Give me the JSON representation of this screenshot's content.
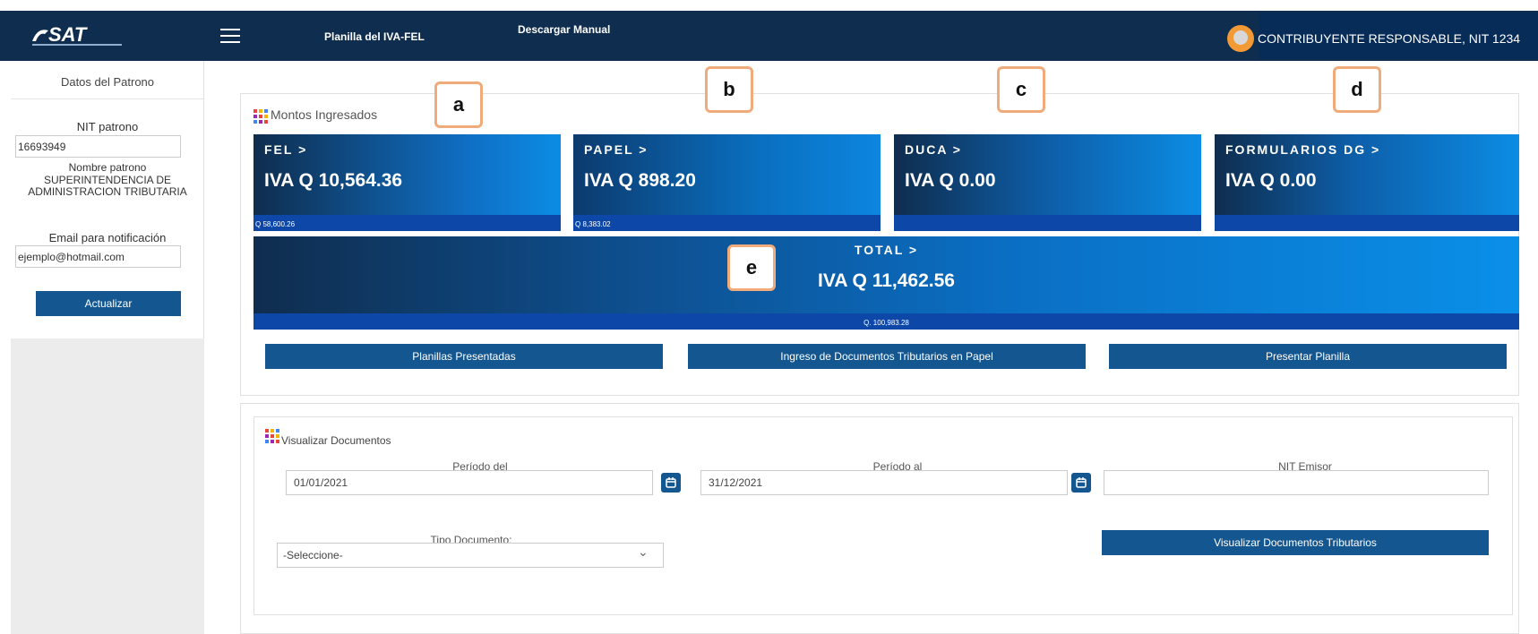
{
  "header": {
    "logo_text": "SAT",
    "menu_icon": "hamburger-icon",
    "planilla_link": "Planilla del IVA-FEL",
    "manual_link": "Descargar Manual",
    "user_label": "CONTRIBUYENTE RESPONSABLE, NIT 1234",
    "colors": {
      "bar": "#0f2d4e",
      "user_box": "#082c58"
    }
  },
  "sidebar": {
    "title": "Datos del Patrono",
    "nit_label": "NIT patrono",
    "nit_value": "16693949",
    "nombre_label": "Nombre patrono",
    "nombre_value": "SUPERINTENDENCIA DE ADMINISTRACION TRIBUTARIA",
    "email_label": "Email para notificación",
    "email_value": "ejemplo@hotmail.com",
    "update_button": "Actualizar"
  },
  "montos": {
    "title": "Montos Ingresados",
    "cards": [
      {
        "title": "FEL  >",
        "value": "IVA Q 10,564.36",
        "sub": "Q 58,600.26"
      },
      {
        "title": "PAPEL  >",
        "value": "IVA Q 898.20",
        "sub": "Q 8,383.02"
      },
      {
        "title": "DUCA  >",
        "value": "IVA Q 0.00",
        "sub": ""
      },
      {
        "title": "FORMULARIOS DG  >",
        "value": "IVA Q 0.00",
        "sub": ""
      }
    ],
    "total": {
      "title": "TOTAL  >",
      "value": "IVA Q 11,462.56",
      "sub": "Q. 100,983.28"
    },
    "buttons": {
      "planillas": "Planillas Presentadas",
      "ingreso": "Ingreso de Documentos Tributarios en Papel",
      "presentar": "Presentar Planilla"
    }
  },
  "annotations": [
    "a",
    "b",
    "c",
    "d",
    "e"
  ],
  "visualizar": {
    "title": "Visualizar Documentos",
    "periodo_del_label": "Período del",
    "periodo_del_value": "01/01/2021",
    "periodo_al_label": "Período al",
    "periodo_al_value": "31/12/2021",
    "nit_emisor_label": "NIT Emisor",
    "nit_emisor_value": "",
    "tipo_label": "Tipo Documento:",
    "tipo_value": "-Seleccione-",
    "button": "Visualizar Documentos Tributarios",
    "calendar_icon": "calendar-icon"
  },
  "colors": {
    "primary_button": "#14568f",
    "annotation_border": "#f1ab7a",
    "dots": [
      "#e8453c",
      "#f4b400",
      "#4285f4",
      "#9c27b0"
    ]
  }
}
